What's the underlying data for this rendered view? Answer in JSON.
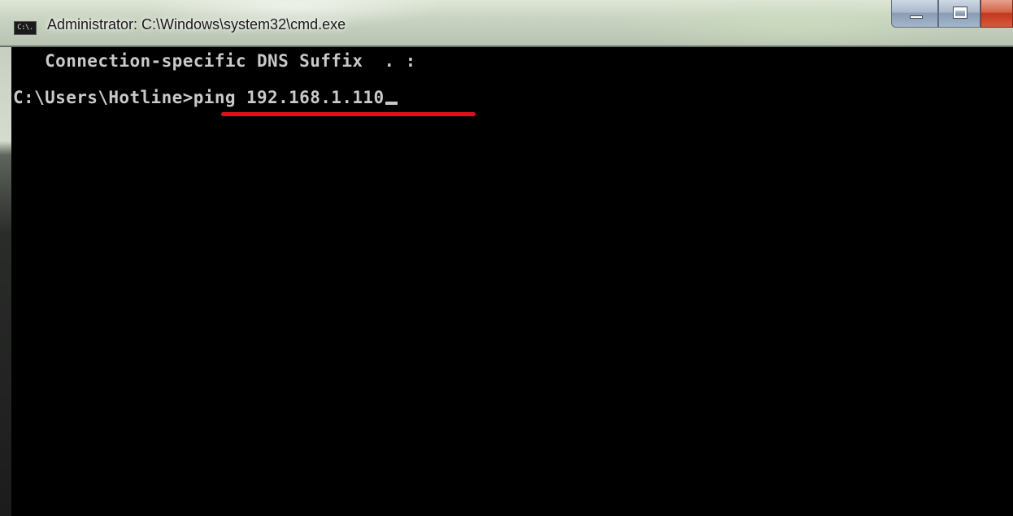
{
  "window": {
    "title": "Administrator: C:\\Windows\\system32\\cmd.exe",
    "icon_text": "C:\\.",
    "icon_name": "cmd-icon"
  },
  "caption_buttons": {
    "minimize_icon": "minimize-icon",
    "maximize_icon": "maximize-icon",
    "close_icon": "close-icon"
  },
  "console": {
    "lines": [
      "   Connection-specific DNS Suffix  . :",
      ""
    ],
    "prompt": "C:\\Users\\Hotline>",
    "command": "ping 192.168.1.110"
  },
  "colors": {
    "console_background": "#000000",
    "console_text": "#c9c9c9",
    "highlight_underline": "#e0101a"
  }
}
